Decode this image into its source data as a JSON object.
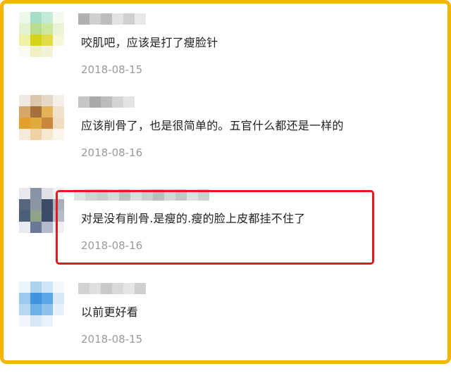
{
  "colors": {
    "frame": "#f5b400",
    "highlight": "#e5191d",
    "date": "#9a9a9a",
    "text": "#222222"
  },
  "comments": [
    {
      "text": "咬肌吧，应该是打了瘦脸针",
      "date": "2018-08-15",
      "avatar_colors": [
        "#eef8ea",
        "#a6dfc8",
        "#c4ead8",
        "#f4faef",
        "#e4f2cf",
        "#b9dd8e",
        "#cce89e",
        "#e8f3d7",
        "#eef2a6",
        "#d4d31a",
        "#e0dc4a",
        "#f6f6d8",
        "#fafaf0",
        "#f1f0c4",
        "#f3f2d4",
        "#ffffff"
      ],
      "name_colors": [
        "#b0b0b0",
        "#cfcfcf",
        "#bdbdbd",
        "#e2e2e2",
        "#d0d0d0",
        "#e9e9e9"
      ],
      "highlighted": false
    },
    {
      "text": "应该削骨了，也是很简单的。五官什么都还是一样的",
      "date": "2018-08-16",
      "avatar_colors": [
        "#f1e9e1",
        "#dcc7ad",
        "#e6d8c6",
        "#f5efe9",
        "#d6a66a",
        "#a4703c",
        "#e3b259",
        "#efe1cc",
        "#e2a02e",
        "#dfab3c",
        "#c9883f",
        "#f0dcc0",
        "#f5ead9",
        "#efd2a3",
        "#f6e8cf",
        "#fbf5ee"
      ],
      "name_colors": [
        "#c6c6c6",
        "#a8a8a8",
        "#bcbcbc",
        "#d4d4d4",
        "#e3e3e3"
      ],
      "highlighted": false
    },
    {
      "text": "对是没有削骨.是瘦的.瘦的脸上皮都挂不住了",
      "date": "2018-08-16",
      "avatar_colors": [
        "#e7e9ee",
        "#8993a6",
        "#dfe1e6",
        "#eef0f3",
        "#57657d",
        "#8c96a2",
        "#3c4b66",
        "#a9b0bb",
        "#4d5e7a",
        "#8fa28a",
        "#3b4c68",
        "#b5bdc9",
        "#e8ebf0",
        "#6b7a94",
        "#b4bccb",
        "#eef0f4"
      ],
      "name_colors": [
        "#e2e2e2",
        "#d2d2d2",
        "#cbcbcb",
        "#d9d9d9",
        "#bfbfbf",
        "#dcdcdc",
        "#cdcdcd",
        "#bcbcbc",
        "#d6d6d6",
        "#c5c5c5",
        "#e0e0e0",
        "#cfcfcf"
      ],
      "highlighted": true
    },
    {
      "text": "以前更好看",
      "date": "2018-08-15",
      "avatar_colors": [
        "#eaf4fb",
        "#aed3ee",
        "#cfe4f4",
        "#f3f8fc",
        "#9ccaef",
        "#3f93df",
        "#5aa6e6",
        "#d8eaf7",
        "#b5d7f0",
        "#6db1e8",
        "#8ec2ec",
        "#e6f1fa",
        "#f0f6fb",
        "#d6e8f6",
        "#e9f2fa",
        "#ffffff"
      ],
      "name_colors": [
        "#d2d2d2",
        "#dfdfdf",
        "#c9c9c9",
        "#d9d9d9",
        "#e6e6e6",
        "#cfcfcf"
      ],
      "highlighted": false
    }
  ]
}
